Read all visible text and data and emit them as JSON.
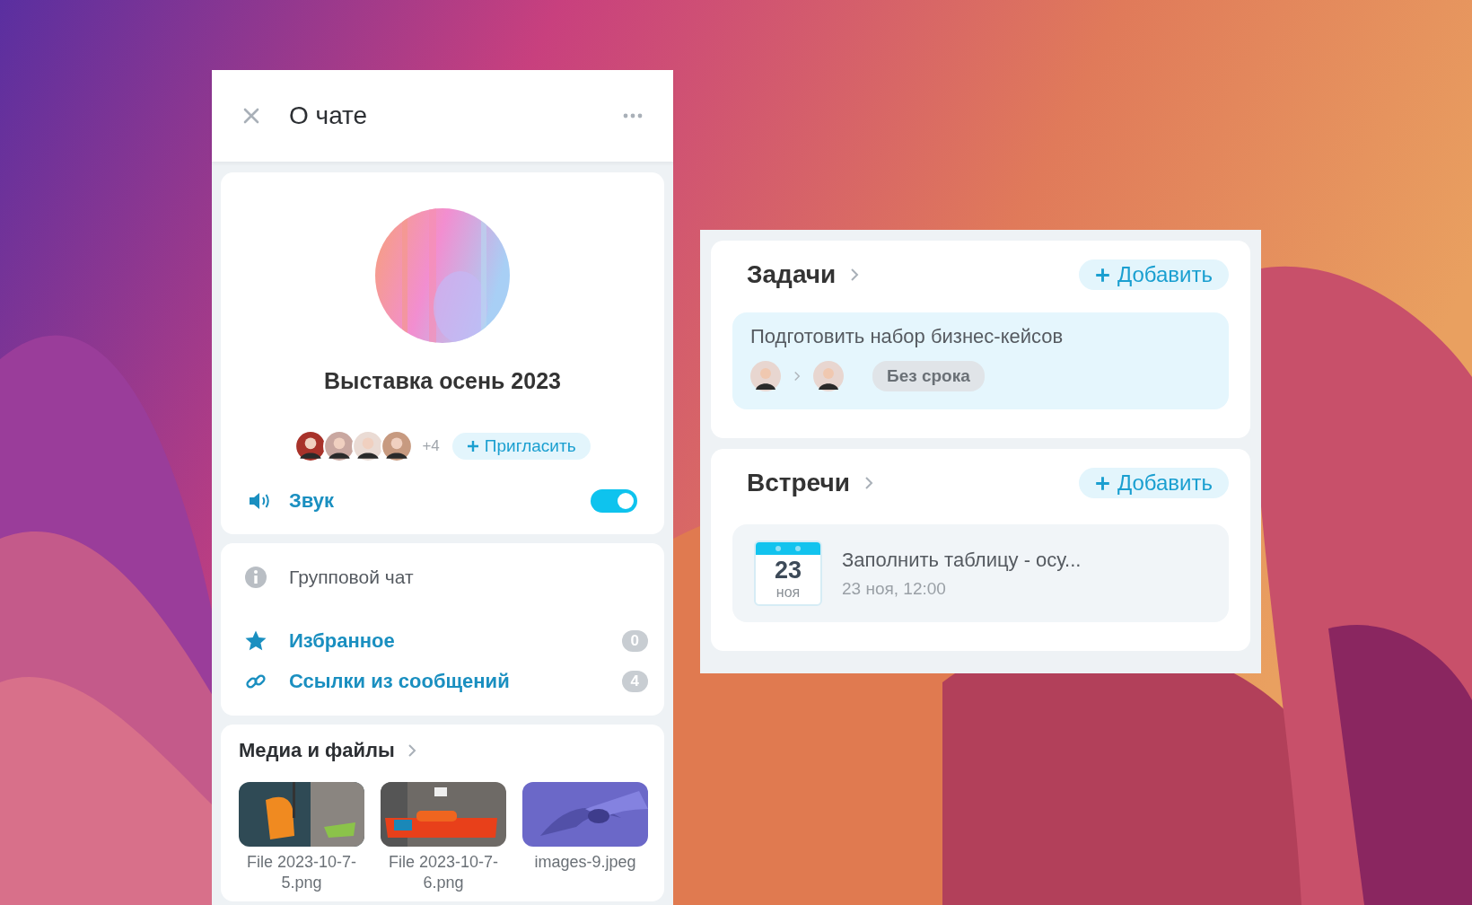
{
  "chat_panel": {
    "title": "О чате",
    "profile": {
      "name": "Выставка осень 2023",
      "extra_members": "+4",
      "invite": "Пригласить"
    },
    "sound": {
      "label": "Звук",
      "on": true
    },
    "info": {
      "chat_type": "Групповой чат"
    },
    "links": [
      {
        "kind": "favorites",
        "label": "Избранное",
        "count": "0"
      },
      {
        "kind": "links",
        "label": "Ссылки из сообщений",
        "count": "4"
      }
    ],
    "media": {
      "title": "Медиа и файлы",
      "files": [
        {
          "name": "File 2023-10-7-5.png",
          "kind": "picture"
        },
        {
          "name": "File 2023-10-7-6.png",
          "kind": "picture"
        },
        {
          "name": "images-9.jpeg",
          "kind": "picture"
        }
      ]
    }
  },
  "tasks": {
    "title": "Задачи",
    "add_button": "Добавить",
    "items": [
      {
        "title": "Подготовить набор бизнес-кейсов",
        "deadline": "Без срока"
      }
    ]
  },
  "meetings": {
    "title": "Встречи",
    "add_button": "Добавить",
    "items": [
      {
        "title": "Заполнить таблицу - осу...",
        "day": "23",
        "month": "ноя",
        "when": "23 ноя, 12:00"
      }
    ]
  }
}
